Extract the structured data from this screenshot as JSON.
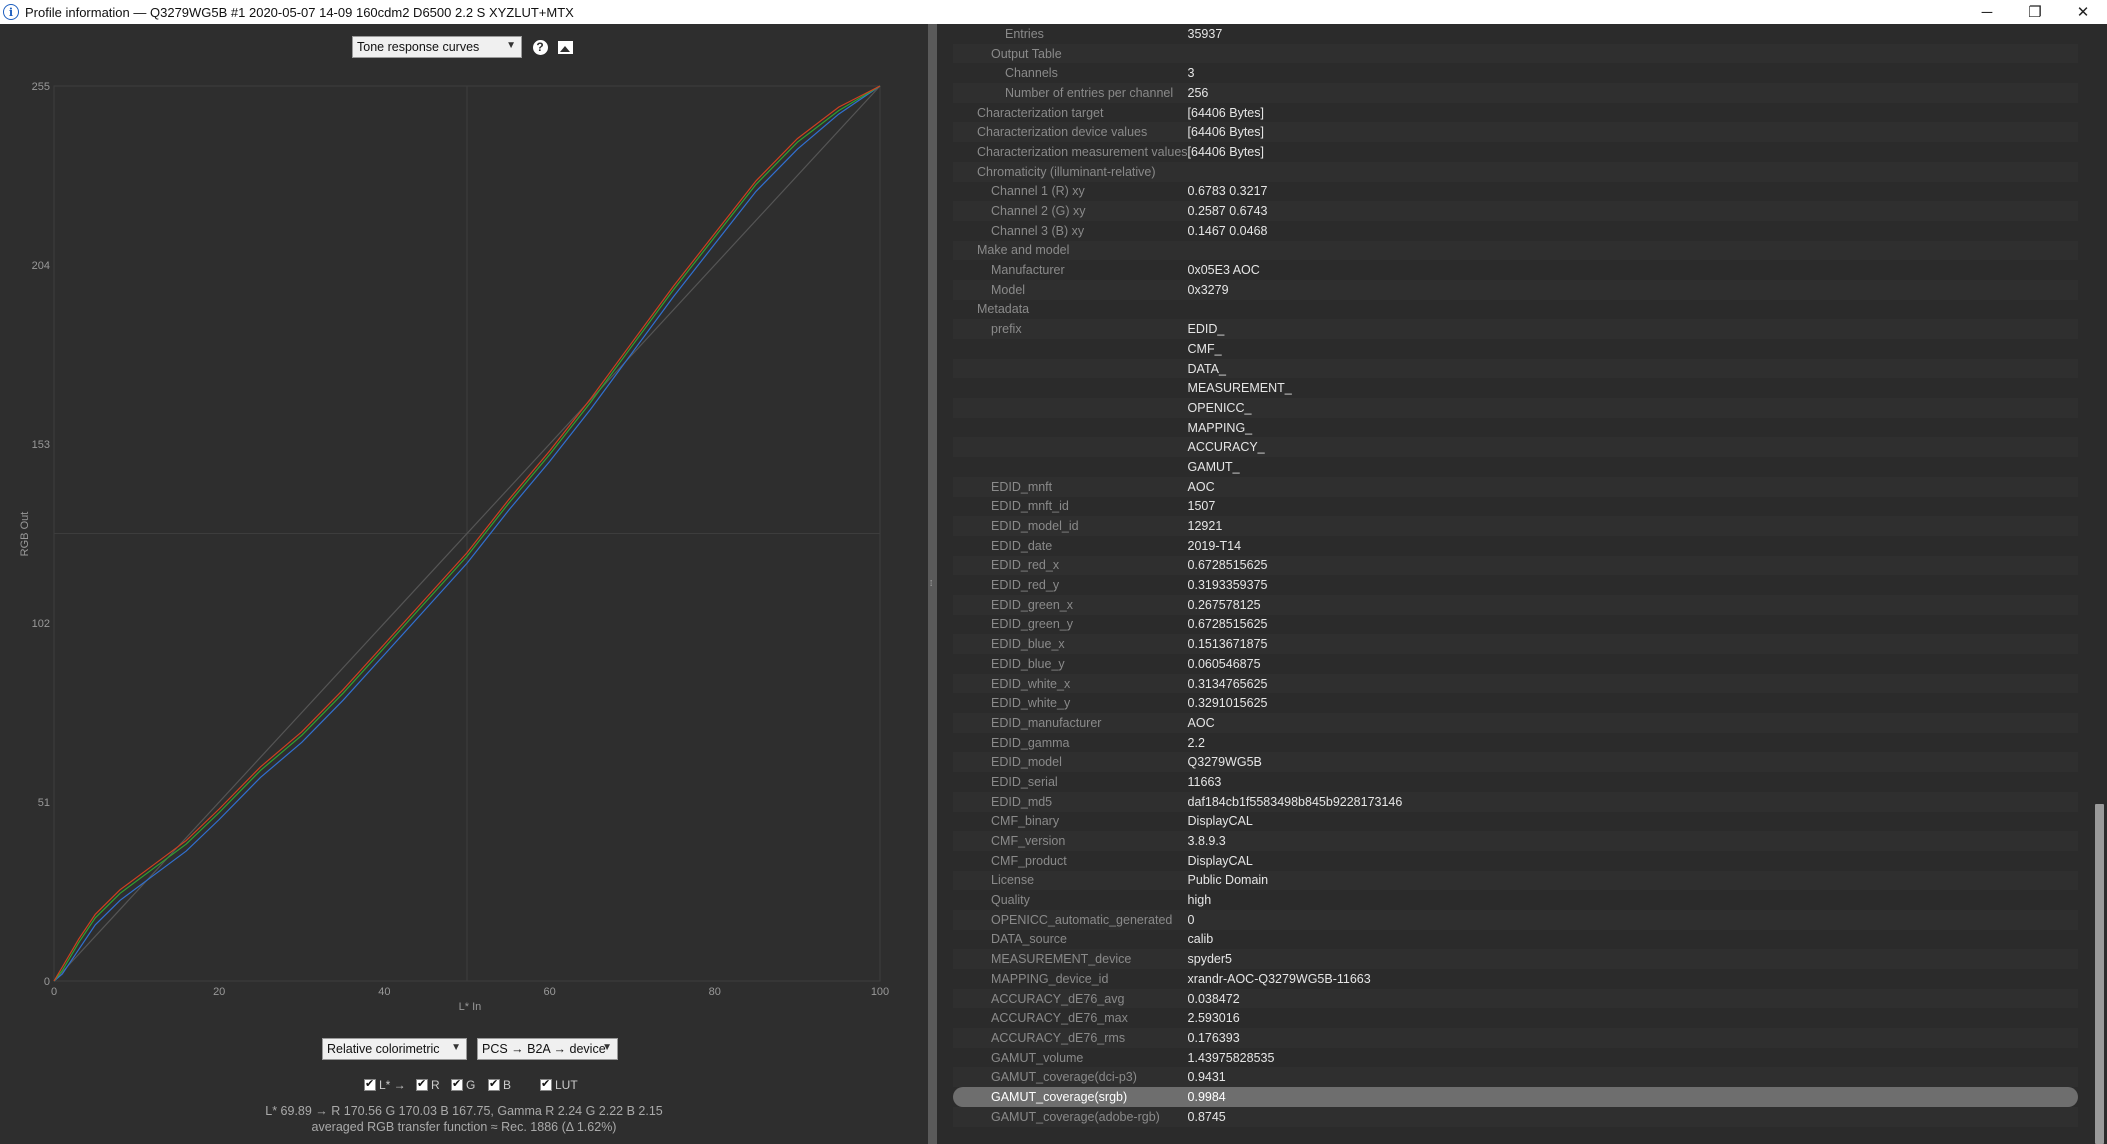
{
  "window": {
    "title": "Profile information — Q3279WG5B #1 2020-05-07 14-09 160cdm2 D6500 2.2 S XYZLUT+MTX",
    "minimize": "─",
    "restore": "❐",
    "close": "✕"
  },
  "toolbar": {
    "view_select": "Tone response curves",
    "help_icon": "?",
    "image_icon": "image-icon"
  },
  "chart_data": {
    "type": "line",
    "title": "",
    "xlabel": "L* In",
    "ylabel": "RGB Out",
    "xlim": [
      0,
      100
    ],
    "ylim": [
      0,
      255
    ],
    "xticks": [
      0,
      20,
      40,
      60,
      80,
      100
    ],
    "yticks": [
      0,
      51,
      102,
      153,
      204,
      255
    ],
    "grid": "center crosshair",
    "series": [
      {
        "name": "R",
        "color": "#d04020",
        "x": [
          0,
          1,
          3,
          5,
          8,
          12,
          16,
          20,
          25,
          30,
          35,
          40,
          45,
          50,
          55,
          60,
          65,
          70,
          75,
          80,
          85,
          90,
          95,
          100
        ],
        "values": [
          0,
          4,
          12,
          19,
          26,
          33,
          40,
          49,
          61,
          71,
          83,
          96,
          109,
          122,
          137,
          151,
          166,
          182,
          198,
          213,
          228,
          240,
          249,
          255
        ]
      },
      {
        "name": "G",
        "color": "#30a030",
        "x": [
          0,
          1,
          3,
          5,
          8,
          12,
          16,
          20,
          25,
          30,
          35,
          40,
          45,
          50,
          55,
          60,
          65,
          70,
          75,
          80,
          85,
          90,
          95,
          100
        ],
        "values": [
          0,
          3,
          11,
          18,
          25,
          32,
          39,
          48,
          60,
          70,
          82,
          95,
          108,
          121,
          136,
          150,
          165,
          181,
          197,
          212,
          227,
          239,
          248,
          255
        ]
      },
      {
        "name": "B",
        "color": "#3070d0",
        "x": [
          0,
          1,
          3,
          5,
          8,
          12,
          16,
          20,
          25,
          30,
          35,
          40,
          45,
          50,
          55,
          60,
          65,
          70,
          75,
          80,
          85,
          90,
          95,
          100
        ],
        "values": [
          0,
          2,
          9,
          16,
          23,
          30,
          37,
          46,
          58,
          68,
          80,
          93,
          106,
          119,
          134,
          148,
          163,
          179,
          195,
          210,
          225,
          237,
          247,
          255
        ]
      },
      {
        "name": "L* →",
        "color": "#555555",
        "x": [
          0,
          100
        ],
        "values": [
          0,
          255
        ]
      }
    ]
  },
  "controls": {
    "intent_select": "Relative colorimetric",
    "direction_select": "PCS → B2A → device",
    "checkboxes": [
      "L* →",
      "R",
      "G",
      "B",
      "LUT"
    ]
  },
  "status": {
    "line1": "L* 69.89 → R 170.56 G 170.03 B 167.75, Gamma R 2.24 G 2.22 B 2.15",
    "line2": "averaged RGB transfer function ≈ Rec. 1886 (Δ 1.62%)"
  },
  "properties": [
    {
      "key": "Entries",
      "value": "35937",
      "indent": 2
    },
    {
      "key": "Output Table",
      "value": "",
      "indent": 1
    },
    {
      "key": "Channels",
      "value": "3",
      "indent": 2
    },
    {
      "key": "Number of entries per channel",
      "value": "256",
      "indent": 2
    },
    {
      "key": "Characterization target",
      "value": "[64406 Bytes]",
      "indent": 0
    },
    {
      "key": "Characterization device values",
      "value": "[64406 Bytes]",
      "indent": 0
    },
    {
      "key": "Characterization measurement values",
      "value": "[64406 Bytes]",
      "indent": 0
    },
    {
      "key": "Chromaticity (illuminant-relative)",
      "value": "",
      "indent": 0
    },
    {
      "key": "Channel 1 (R) xy",
      "value": "0.6783 0.3217",
      "indent": 1
    },
    {
      "key": "Channel 2 (G) xy",
      "value": "0.2587 0.6743",
      "indent": 1
    },
    {
      "key": "Channel 3 (B) xy",
      "value": "0.1467 0.0468",
      "indent": 1
    },
    {
      "key": "Make and model",
      "value": "",
      "indent": 0
    },
    {
      "key": "Manufacturer",
      "value": "0x05E3 AOC",
      "indent": 1
    },
    {
      "key": "Model",
      "value": "0x3279",
      "indent": 1
    },
    {
      "key": "Metadata",
      "value": "",
      "indent": 0
    },
    {
      "key": "prefix",
      "value": "EDID_",
      "indent": 1
    },
    {
      "key": "",
      "value": "CMF_",
      "indent": 1
    },
    {
      "key": "",
      "value": "DATA_",
      "indent": 1
    },
    {
      "key": "",
      "value": "MEASUREMENT_",
      "indent": 1
    },
    {
      "key": "",
      "value": "OPENICC_",
      "indent": 1
    },
    {
      "key": "",
      "value": "MAPPING_",
      "indent": 1
    },
    {
      "key": "",
      "value": "ACCURACY_",
      "indent": 1
    },
    {
      "key": "",
      "value": "GAMUT_",
      "indent": 1
    },
    {
      "key": "EDID_mnft",
      "value": "AOC",
      "indent": 1
    },
    {
      "key": "EDID_mnft_id",
      "value": "1507",
      "indent": 1
    },
    {
      "key": "EDID_model_id",
      "value": "12921",
      "indent": 1
    },
    {
      "key": "EDID_date",
      "value": "2019-T14",
      "indent": 1
    },
    {
      "key": "EDID_red_x",
      "value": "0.6728515625",
      "indent": 1
    },
    {
      "key": "EDID_red_y",
      "value": "0.3193359375",
      "indent": 1
    },
    {
      "key": "EDID_green_x",
      "value": "0.267578125",
      "indent": 1
    },
    {
      "key": "EDID_green_y",
      "value": "0.6728515625",
      "indent": 1
    },
    {
      "key": "EDID_blue_x",
      "value": "0.1513671875",
      "indent": 1
    },
    {
      "key": "EDID_blue_y",
      "value": "0.060546875",
      "indent": 1
    },
    {
      "key": "EDID_white_x",
      "value": "0.3134765625",
      "indent": 1
    },
    {
      "key": "EDID_white_y",
      "value": "0.3291015625",
      "indent": 1
    },
    {
      "key": "EDID_manufacturer",
      "value": "AOC",
      "indent": 1
    },
    {
      "key": "EDID_gamma",
      "value": "2.2",
      "indent": 1
    },
    {
      "key": "EDID_model",
      "value": "Q3279WG5B",
      "indent": 1
    },
    {
      "key": "EDID_serial",
      "value": "11663",
      "indent": 1
    },
    {
      "key": "EDID_md5",
      "value": "daf184cb1f5583498b845b9228173146",
      "indent": 1
    },
    {
      "key": "CMF_binary",
      "value": "DisplayCAL",
      "indent": 1
    },
    {
      "key": "CMF_version",
      "value": "3.8.9.3",
      "indent": 1
    },
    {
      "key": "CMF_product",
      "value": "DisplayCAL",
      "indent": 1
    },
    {
      "key": "License",
      "value": "Public Domain",
      "indent": 1
    },
    {
      "key": "Quality",
      "value": "high",
      "indent": 1
    },
    {
      "key": "OPENICC_automatic_generated",
      "value": "0",
      "indent": 1
    },
    {
      "key": "DATA_source",
      "value": "calib",
      "indent": 1
    },
    {
      "key": "MEASUREMENT_device",
      "value": "spyder5",
      "indent": 1
    },
    {
      "key": "MAPPING_device_id",
      "value": "xrandr-AOC-Q3279WG5B-11663",
      "indent": 1
    },
    {
      "key": "ACCURACY_dE76_avg",
      "value": "0.038472",
      "indent": 1
    },
    {
      "key": "ACCURACY_dE76_max",
      "value": "2.593016",
      "indent": 1
    },
    {
      "key": "ACCURACY_dE76_rms",
      "value": "0.176393",
      "indent": 1
    },
    {
      "key": "GAMUT_volume",
      "value": "1.43975828535",
      "indent": 1
    },
    {
      "key": "GAMUT_coverage(dci-p3)",
      "value": "0.9431",
      "indent": 1
    },
    {
      "key": "GAMUT_coverage(srgb)",
      "value": "0.9984",
      "indent": 1,
      "selected": true
    },
    {
      "key": "GAMUT_coverage(adobe-rgb)",
      "value": "0.8745",
      "indent": 1
    }
  ]
}
